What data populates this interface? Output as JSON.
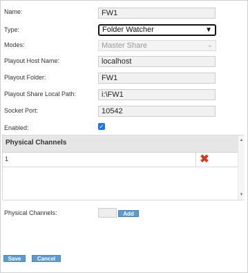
{
  "form": {
    "name_label": "Name:",
    "name_value": "FW1",
    "type_label": "Type:",
    "type_value": "Folder Watcher",
    "modes_label": "Modes:",
    "modes_value": "Master Share",
    "host_label": "Playout Host Name:",
    "host_value": "localhost",
    "folder_label": "Playout Folder:",
    "folder_value": "FW1",
    "share_label": "Playout Share Local Path:",
    "share_value": "i:\\FW1",
    "port_label": "Socket Port:",
    "port_value": "10542",
    "enabled_label": "Enabled:",
    "enabled_checked": true
  },
  "channels_grid": {
    "header": "Physical Channels",
    "rows": [
      {
        "value": "1"
      }
    ]
  },
  "add_channel": {
    "label": "Physical Channels:",
    "add_label": "Add"
  },
  "actions": {
    "save_label": "Save",
    "cancel_label": "Cancel"
  },
  "icons": {
    "delete": "delete-x-icon",
    "dropdown": "chevron-down-icon",
    "checkbox": "check-icon"
  },
  "colors": {
    "button": "#5b9bd5",
    "delete_icon": "#d43b1c",
    "checkbox": "#1a73e8"
  }
}
